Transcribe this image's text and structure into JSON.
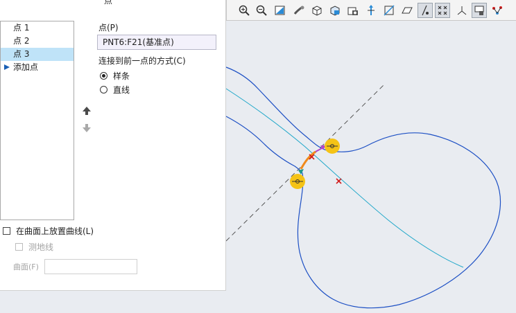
{
  "toolbar": {
    "icons": [
      "zoom-in-icon",
      "zoom-out-icon",
      "refit-icon",
      "repaint-icon",
      "display-style-icon",
      "saved-orientations-icon",
      "view-manager-icon",
      "perspective-icon",
      "plane-display-icon",
      "axis-display-icon",
      "point-display-icon",
      "csys-display-icon",
      "annotation-display-icon",
      "spin-center-icon",
      "more-display-icon"
    ],
    "active": [
      "point-display-icon",
      "csys-display-icon",
      "annotation-display-icon"
    ]
  },
  "panel": {
    "header_cut": "点",
    "points": [
      "点 1",
      "点 2",
      "点 3"
    ],
    "selected_index": 2,
    "add_point": "添加点",
    "point_label": "点(P)",
    "point_value": "PNT6:F21(基准点)",
    "connect_label": "连接到前一点的方式(C)",
    "connect_options": [
      {
        "label": "样条",
        "checked": true
      },
      {
        "label": "直线",
        "checked": false
      }
    ],
    "place_on_surface": "在曲面上放置曲线(L)",
    "geodesic": "测地线",
    "surface_label": "曲面(F)"
  },
  "colors": {
    "curve_blue": "#1c4fc4",
    "curve_cyan": "#1fa7c9",
    "datum_dash": "#555555",
    "marker_yellow": "#f5c316",
    "selection_orange": "#f08a1c",
    "list_selected": "#bfe3f8"
  }
}
